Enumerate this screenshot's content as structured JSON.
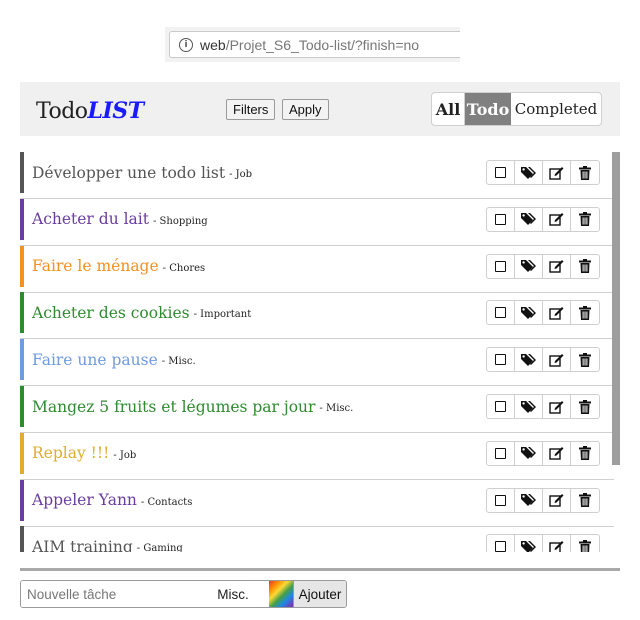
{
  "browser": {
    "url_host": "web",
    "url_path": "/Projet_S6_Todo-list/?finish=no",
    "info_icon": "info-icon"
  },
  "header": {
    "brand_todo": "Todo",
    "brand_list": "LIST",
    "filters_label": "Filters",
    "apply_label": "Apply",
    "view_tabs": [
      "All",
      "Todo",
      "Completed"
    ],
    "active_tab": "Todo"
  },
  "tasks": [
    {
      "title": "Développer une todo list",
      "category": "- Job",
      "color": "#555555"
    },
    {
      "title": "Acheter du lait",
      "category": "- Shopping",
      "color": "#6a3da0"
    },
    {
      "title": "Faire le ménage",
      "category": "- Chores",
      "color": "#f39121"
    },
    {
      "title": "Acheter des cookies",
      "category": "- Important",
      "color": "#2e8b2e"
    },
    {
      "title": "Faire une pause",
      "category": "- Misc.",
      "color": "#6f9be0"
    },
    {
      "title": "Mangez 5 fruits et légumes par jour",
      "category": "- Misc.",
      "color": "#2e8b2e"
    },
    {
      "title": "Replay !!!",
      "category": "- Job",
      "color": "#e0ad2e"
    },
    {
      "title": "Appeler Yann",
      "category": "- Contacts",
      "color": "#6a3da0"
    },
    {
      "title": "AIM training",
      "category": "- Gaming",
      "color": "#555555"
    }
  ],
  "task_actions": [
    "checkbox-icon",
    "tags-icon",
    "edit-icon",
    "trash-icon"
  ],
  "new_task": {
    "placeholder": "Nouvelle tâche",
    "category": "Misc.",
    "add_label": "Ajouter"
  }
}
